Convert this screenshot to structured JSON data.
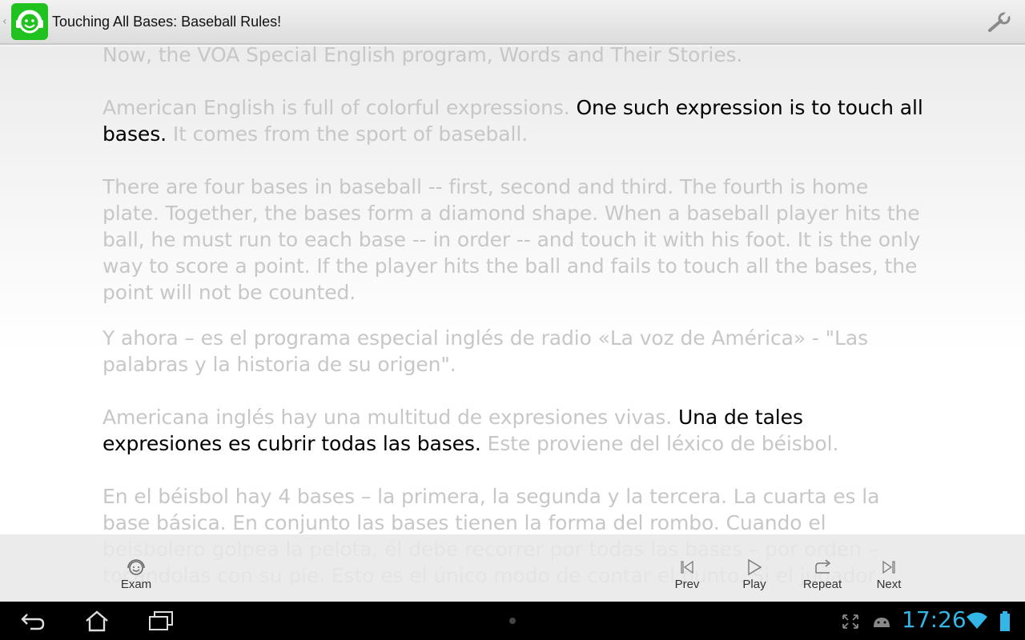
{
  "actionbar": {
    "title": "Touching All Bases: Baseball Rules!",
    "up_icon": "chevron-left-icon",
    "app_icon": "smiley-headphones-icon",
    "settings_icon": "wrench-icon",
    "app_icon_color": "#1fc21f"
  },
  "english": {
    "p1": "Now, the VOA Special English program, Words and Their Stories.",
    "p2_pre": "American English is full of colorful expressions. ",
    "p2_hl": "One such expression is to touch all bases.",
    "p2_post": " It comes from the sport of baseball.",
    "p3": "There are four bases in baseball -- first, second and third. The fourth is home plate. Together, the bases form a diamond shape. When a baseball player hits the ball, he must run to each base -- in order -- and touch it with his foot. It is the only way to score a point. If the player hits the ball and fails to touch all the bases, the point will not be counted."
  },
  "spanish": {
    "p1": "Y ahora – es el programa especial inglés de radio «La voz de América» - \"Las palabras y la historia de su origen\".",
    "p2_pre": "Americana inglés hay una multitud de expresiones vivas. ",
    "p2_hl": "Una de tales expresiones es cubrir todas las bases.",
    "p2_post": " Este proviene del léxico de béisbol.",
    "p3": "En el béisbol hay 4 bases – la primera, la segunda y la tercera. La cuarta es la base básica. En conjunto las bases tienen la forma del rombo. Cuando el beisbolero golpea la pelota, él debe recorrer por todas las bases – por orden – tocándolas con su pie. Esto es el único modo de contar el punto. Si el jugador"
  },
  "controls": {
    "exam": "Exam",
    "prev": "Prev",
    "play": "Play",
    "repeat": "Repeat",
    "next": "Next"
  },
  "statusbar": {
    "time": "17:26",
    "icons": [
      "fullscreen-icon",
      "android-icon",
      "wifi-icon",
      "battery-icon"
    ],
    "nav_icons": [
      "back-icon",
      "home-icon",
      "recent-apps-icon"
    ],
    "clock_color": "#33b5e5"
  }
}
